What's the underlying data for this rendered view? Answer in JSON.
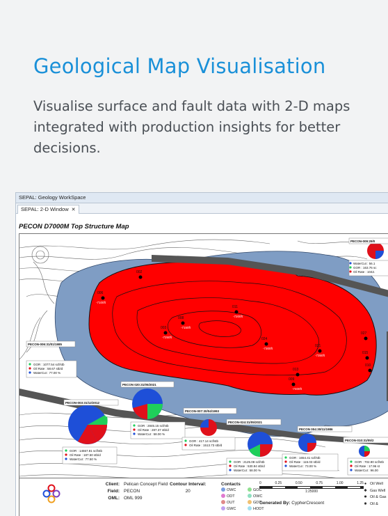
{
  "card": {
    "title": "Geological Map Visualisation",
    "description": "Visualise surface and fault data with 2-D maps integrated with production insights for better decisions."
  },
  "app": {
    "window_title": "SEPAL: Geology WorkSpace",
    "tab_label": "SEPAL: 2-D Window",
    "tab_close": "✕",
    "map_title": "PECON D7000M Top Structure Map"
  },
  "colors": {
    "accent": "#1a90d8",
    "reservoir": "#ff0000",
    "aquifer": "#7f9dc4",
    "fault": "#555555",
    "pie_blue": "#1e4fd8",
    "pie_red": "#e0101a",
    "pie_green": "#1fcf5a"
  },
  "wells": {
    "labels": [
      "PECON-009:29/0",
      "PECON-006:31/01/1985",
      "PECON-003:31/12/2012",
      "PECON 020:31/05/2021",
      "PECON-007:30/04/1993",
      "PECON-024:31/05/2021",
      "PECON 004:30/11/1986",
      "PECON-010:31/05/2"
    ],
    "map_points": [
      "002",
      "006",
      "008",
      "011",
      "003",
      "024",
      "021",
      "013",
      "027",
      "015",
      "010",
      "009"
    ],
    "contour_labels": [
      "-7100ft",
      "-7150ft",
      "-7200ft",
      "-7250ft",
      "-7300ft",
      "-7350ft",
      "-7400ft"
    ]
  },
  "info_boxes": {
    "w009": [
      "WaterCut : 56.1",
      "GOR : 163.76 sc",
      "Oil Rate : 1042."
    ],
    "w006": [
      "GOR : 1077.54 scf/stb",
      "Oil Rate : 58.67 stb/d",
      "WaterCut : 77.00 %"
    ],
    "w003": [
      "GOR : 14557.81 scf/stb",
      "Oil Rate : 187.50 stb/d",
      "WaterCut : 77.50 %"
    ],
    "w020": [
      "GOR : 2845.15 scf/stb",
      "Oil Rate : 287.37 stb/d",
      "WaterCut : 58.00 %"
    ],
    "w007": [
      "GOR : 417.14 scf/stb",
      "Oil Rate : 1513.73 stb/d"
    ],
    "w024": [
      "GOR : 2125.08 scf/stb",
      "Oil Rate : 530.94 stb/d",
      "WaterCut : 58.00 %"
    ],
    "w004": [
      "GOR : 1654.41 scf/stb",
      "Oil Rate : 115.03 stb/d",
      "WaterCut : 73.00 %"
    ],
    "w010": [
      "GOR : 702.90 scf/stb",
      "Oil Rate : 17.96 st",
      "WaterCut : 96.00"
    ]
  },
  "footer": {
    "client_label": "Client:",
    "client": "Pelican Concept Field",
    "field_label": "Field:",
    "field": "PECON",
    "oml_label": "OML:",
    "oml": "OML 999",
    "contour_label": "Contour Interval:",
    "contour_value": "20",
    "contacts_label": "Contacts",
    "contacts": [
      "OWC",
      "GOC",
      "ODT",
      "OWC",
      "OUT",
      "GDT",
      "GWC",
      "HODT"
    ],
    "scale_ticks": [
      "0",
      "0.25",
      "0.50",
      "0.75",
      "1.00",
      "1.25"
    ],
    "scale_units": "1:25000",
    "generated_label": "Generated By:",
    "generated_by": "CypherCrescent",
    "well_legend": [
      "Oil Well",
      "Gas Well",
      "Oil & Gas",
      "Oil & "
    ]
  }
}
